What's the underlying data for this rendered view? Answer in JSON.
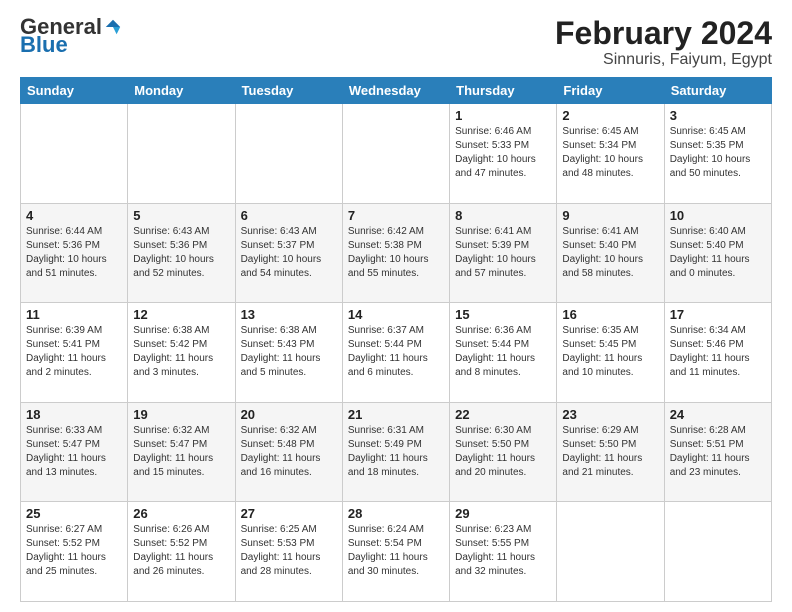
{
  "header": {
    "logo_general": "General",
    "logo_blue": "Blue",
    "title": "February 2024",
    "subtitle": "Sinnuris, Faiyum, Egypt"
  },
  "weekdays": [
    "Sunday",
    "Monday",
    "Tuesday",
    "Wednesday",
    "Thursday",
    "Friday",
    "Saturday"
  ],
  "weeks": [
    [
      {
        "day": "",
        "info": ""
      },
      {
        "day": "",
        "info": ""
      },
      {
        "day": "",
        "info": ""
      },
      {
        "day": "",
        "info": ""
      },
      {
        "day": "1",
        "info": "Sunrise: 6:46 AM\nSunset: 5:33 PM\nDaylight: 10 hours and 47 minutes."
      },
      {
        "day": "2",
        "info": "Sunrise: 6:45 AM\nSunset: 5:34 PM\nDaylight: 10 hours and 48 minutes."
      },
      {
        "day": "3",
        "info": "Sunrise: 6:45 AM\nSunset: 5:35 PM\nDaylight: 10 hours and 50 minutes."
      }
    ],
    [
      {
        "day": "4",
        "info": "Sunrise: 6:44 AM\nSunset: 5:36 PM\nDaylight: 10 hours and 51 minutes."
      },
      {
        "day": "5",
        "info": "Sunrise: 6:43 AM\nSunset: 5:36 PM\nDaylight: 10 hours and 52 minutes."
      },
      {
        "day": "6",
        "info": "Sunrise: 6:43 AM\nSunset: 5:37 PM\nDaylight: 10 hours and 54 minutes."
      },
      {
        "day": "7",
        "info": "Sunrise: 6:42 AM\nSunset: 5:38 PM\nDaylight: 10 hours and 55 minutes."
      },
      {
        "day": "8",
        "info": "Sunrise: 6:41 AM\nSunset: 5:39 PM\nDaylight: 10 hours and 57 minutes."
      },
      {
        "day": "9",
        "info": "Sunrise: 6:41 AM\nSunset: 5:40 PM\nDaylight: 10 hours and 58 minutes."
      },
      {
        "day": "10",
        "info": "Sunrise: 6:40 AM\nSunset: 5:40 PM\nDaylight: 11 hours and 0 minutes."
      }
    ],
    [
      {
        "day": "11",
        "info": "Sunrise: 6:39 AM\nSunset: 5:41 PM\nDaylight: 11 hours and 2 minutes."
      },
      {
        "day": "12",
        "info": "Sunrise: 6:38 AM\nSunset: 5:42 PM\nDaylight: 11 hours and 3 minutes."
      },
      {
        "day": "13",
        "info": "Sunrise: 6:38 AM\nSunset: 5:43 PM\nDaylight: 11 hours and 5 minutes."
      },
      {
        "day": "14",
        "info": "Sunrise: 6:37 AM\nSunset: 5:44 PM\nDaylight: 11 hours and 6 minutes."
      },
      {
        "day": "15",
        "info": "Sunrise: 6:36 AM\nSunset: 5:44 PM\nDaylight: 11 hours and 8 minutes."
      },
      {
        "day": "16",
        "info": "Sunrise: 6:35 AM\nSunset: 5:45 PM\nDaylight: 11 hours and 10 minutes."
      },
      {
        "day": "17",
        "info": "Sunrise: 6:34 AM\nSunset: 5:46 PM\nDaylight: 11 hours and 11 minutes."
      }
    ],
    [
      {
        "day": "18",
        "info": "Sunrise: 6:33 AM\nSunset: 5:47 PM\nDaylight: 11 hours and 13 minutes."
      },
      {
        "day": "19",
        "info": "Sunrise: 6:32 AM\nSunset: 5:47 PM\nDaylight: 11 hours and 15 minutes."
      },
      {
        "day": "20",
        "info": "Sunrise: 6:32 AM\nSunset: 5:48 PM\nDaylight: 11 hours and 16 minutes."
      },
      {
        "day": "21",
        "info": "Sunrise: 6:31 AM\nSunset: 5:49 PM\nDaylight: 11 hours and 18 minutes."
      },
      {
        "day": "22",
        "info": "Sunrise: 6:30 AM\nSunset: 5:50 PM\nDaylight: 11 hours and 20 minutes."
      },
      {
        "day": "23",
        "info": "Sunrise: 6:29 AM\nSunset: 5:50 PM\nDaylight: 11 hours and 21 minutes."
      },
      {
        "day": "24",
        "info": "Sunrise: 6:28 AM\nSunset: 5:51 PM\nDaylight: 11 hours and 23 minutes."
      }
    ],
    [
      {
        "day": "25",
        "info": "Sunrise: 6:27 AM\nSunset: 5:52 PM\nDaylight: 11 hours and 25 minutes."
      },
      {
        "day": "26",
        "info": "Sunrise: 6:26 AM\nSunset: 5:52 PM\nDaylight: 11 hours and 26 minutes."
      },
      {
        "day": "27",
        "info": "Sunrise: 6:25 AM\nSunset: 5:53 PM\nDaylight: 11 hours and 28 minutes."
      },
      {
        "day": "28",
        "info": "Sunrise: 6:24 AM\nSunset: 5:54 PM\nDaylight: 11 hours and 30 minutes."
      },
      {
        "day": "29",
        "info": "Sunrise: 6:23 AM\nSunset: 5:55 PM\nDaylight: 11 hours and 32 minutes."
      },
      {
        "day": "",
        "info": ""
      },
      {
        "day": "",
        "info": ""
      }
    ]
  ]
}
